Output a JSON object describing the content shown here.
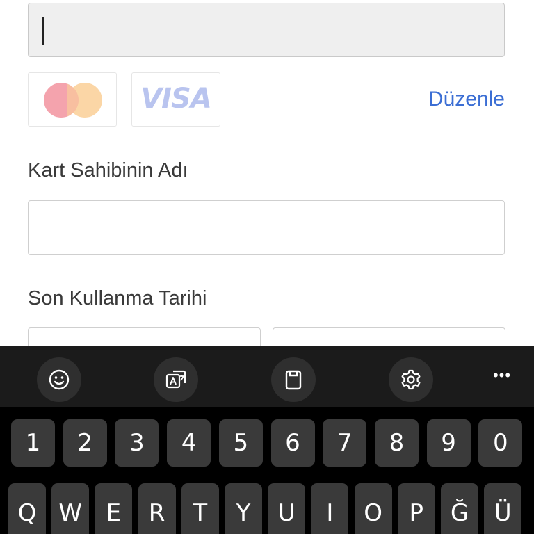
{
  "payment_form": {
    "card_number_value": "",
    "brands": [
      {
        "name": "Mastercard",
        "icon": "mastercard-logo-icon"
      },
      {
        "name": "VISA",
        "icon": "visa-logo-icon"
      }
    ],
    "edit_label": "Düzenle",
    "cardholder_label": "Kart Sahibinin Adı",
    "cardholder_value": "",
    "expiry_label": "Son Kullanma Tarihi",
    "expiry_month_value": "",
    "expiry_year_value": ""
  },
  "keyboard": {
    "toolbar": [
      {
        "icon": "emoji-icon"
      },
      {
        "icon": "translate-icon"
      },
      {
        "icon": "clipboard-icon"
      },
      {
        "icon": "settings-gear-icon"
      },
      {
        "icon": "more-options-icon",
        "label": "•••"
      }
    ],
    "number_row": [
      "1",
      "2",
      "3",
      "4",
      "5",
      "6",
      "7",
      "8",
      "9",
      "0"
    ],
    "letter_row": [
      "Q",
      "W",
      "E",
      "R",
      "T",
      "Y",
      "U",
      "I",
      "O",
      "P",
      "Ğ",
      "Ü"
    ]
  }
}
